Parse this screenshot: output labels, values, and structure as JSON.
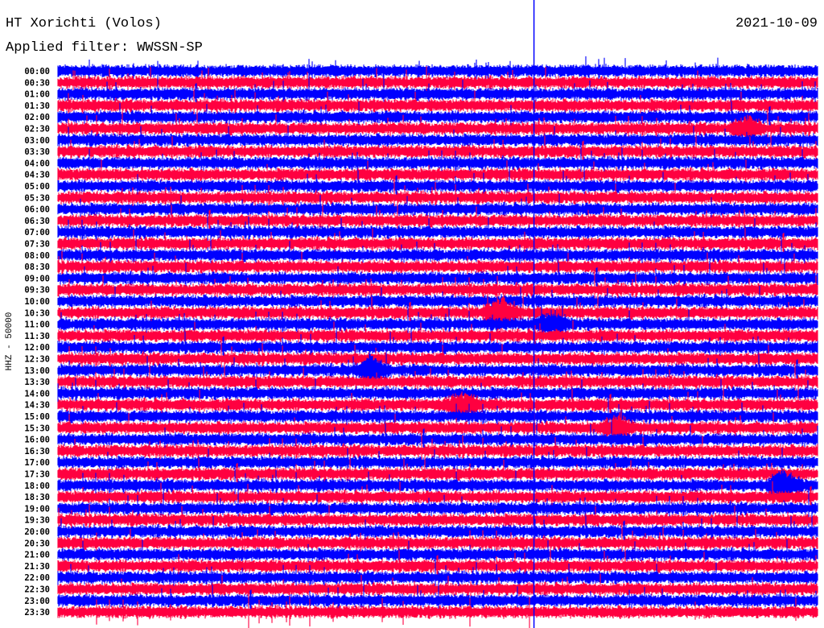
{
  "header": {
    "station": "HT Xorichti (Volos)",
    "date": "2021-10-09",
    "filter": "Applied filter: WWSSN-SP"
  },
  "chart_data": {
    "type": "line",
    "title": "HT Xorichti (Volos)",
    "subtitle": "Applied filter: WWSSN-SP",
    "ylabel": "HHZ - 50000",
    "xlabel": "",
    "x_range_minutes": [
      0,
      30
    ],
    "row_labels": [
      "00:00",
      "00:30",
      "01:00",
      "01:30",
      "02:00",
      "02:30",
      "03:00",
      "03:30",
      "04:00",
      "04:30",
      "05:00",
      "05:30",
      "06:00",
      "06:30",
      "07:00",
      "07:30",
      "08:00",
      "08:30",
      "09:00",
      "09:30",
      "10:00",
      "10:30",
      "11:00",
      "11:30",
      "12:00",
      "12:30",
      "13:00",
      "13:30",
      "14:00",
      "14:30",
      "15:00",
      "15:30",
      "16:00",
      "16:30",
      "17:00",
      "17:30",
      "18:00",
      "18:30",
      "19:00",
      "19:30",
      "20:00",
      "20:30",
      "21:00",
      "21:30",
      "22:00",
      "22:30",
      "23:00",
      "23:30"
    ],
    "colors": [
      "#0000ff",
      "#ff0040"
    ],
    "marker_line_minute": 18.8,
    "events": [
      {
        "row": "10:30",
        "minute": 17.5,
        "amplitude": 2.2
      },
      {
        "row": "11:00",
        "minute": 19.5,
        "amplitude": 1.5
      },
      {
        "row": "13:00",
        "minute": 12.4,
        "amplitude": 1.8
      },
      {
        "row": "14:30",
        "minute": 16.0,
        "amplitude": 1.6
      },
      {
        "row": "15:30",
        "minute": 22.1,
        "amplitude": 1.6
      },
      {
        "row": "18:00",
        "minute": 28.7,
        "amplitude": 2.0
      },
      {
        "row": "02:30",
        "minute": 27.2,
        "amplitude": 1.4
      }
    ]
  }
}
